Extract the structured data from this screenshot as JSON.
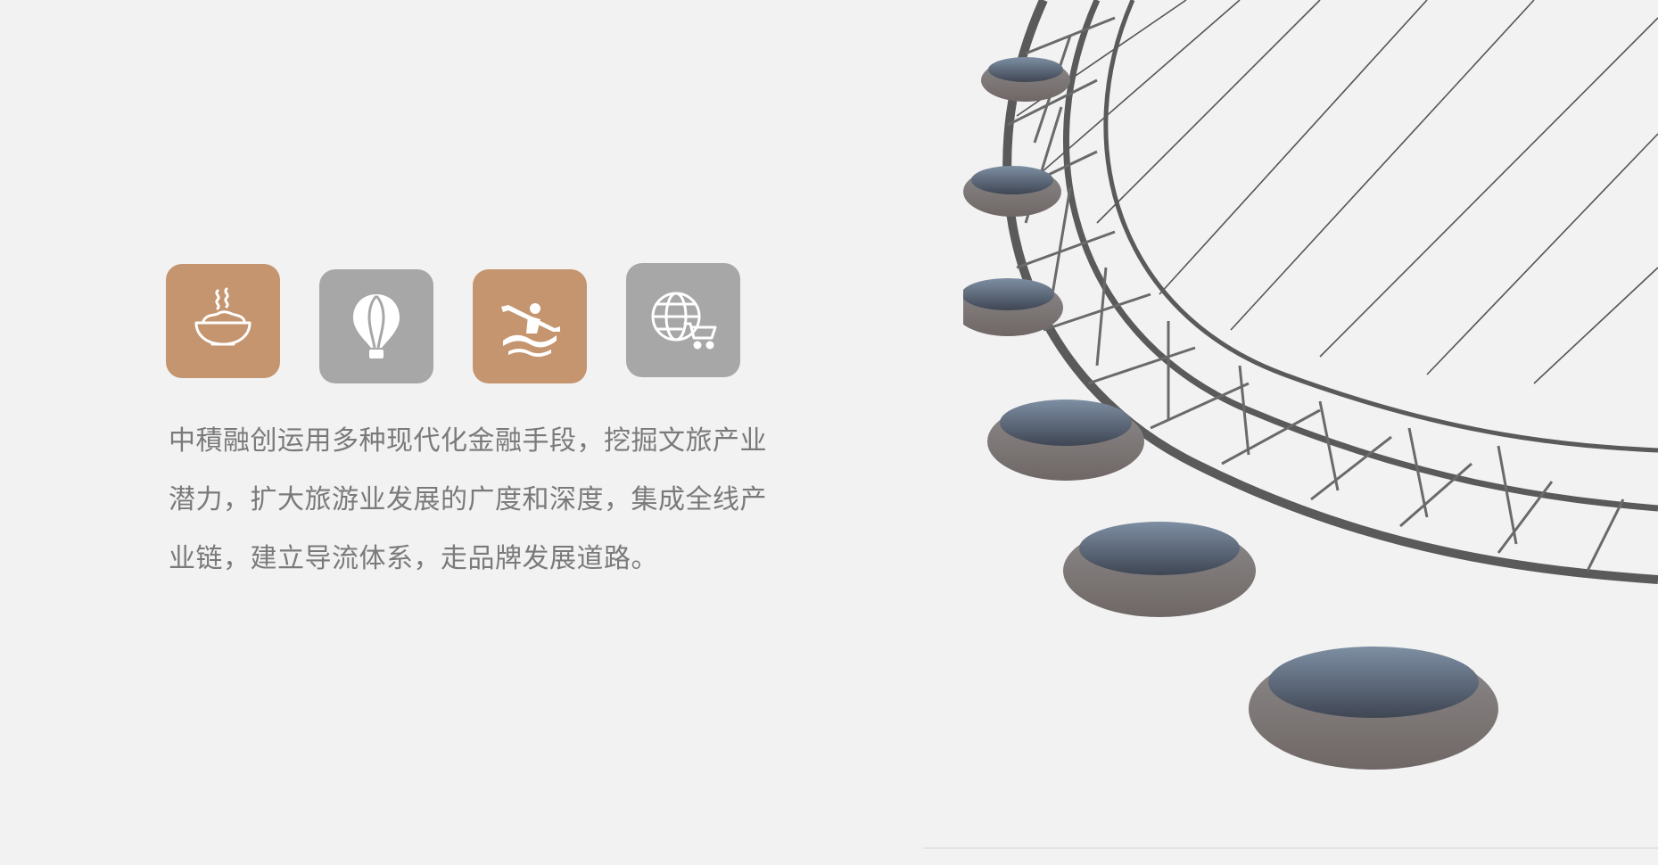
{
  "description_text": "中積融创运用多种现代化金融手段，挖掘文旅产业潜力，扩大旅游业发展的广度和深度，集成全线产业链，建立导流体系，走品牌发展道路。",
  "colors": {
    "background": "#f2f2f2",
    "accent_tan": "#c4956f",
    "neutral_gray": "#a7a7a7",
    "text": "#7a7a7a"
  },
  "icons": [
    {
      "name": "food-bowl-icon",
      "tile_color": "#c4956f"
    },
    {
      "name": "hot-air-balloon-icon",
      "tile_color": "#a7a7a7"
    },
    {
      "name": "kayak-paddler-icon",
      "tile_color": "#c4956f"
    },
    {
      "name": "globe-cart-icon",
      "tile_color": "#a7a7a7"
    }
  ],
  "photo": {
    "subject": "ferris-wheel"
  }
}
